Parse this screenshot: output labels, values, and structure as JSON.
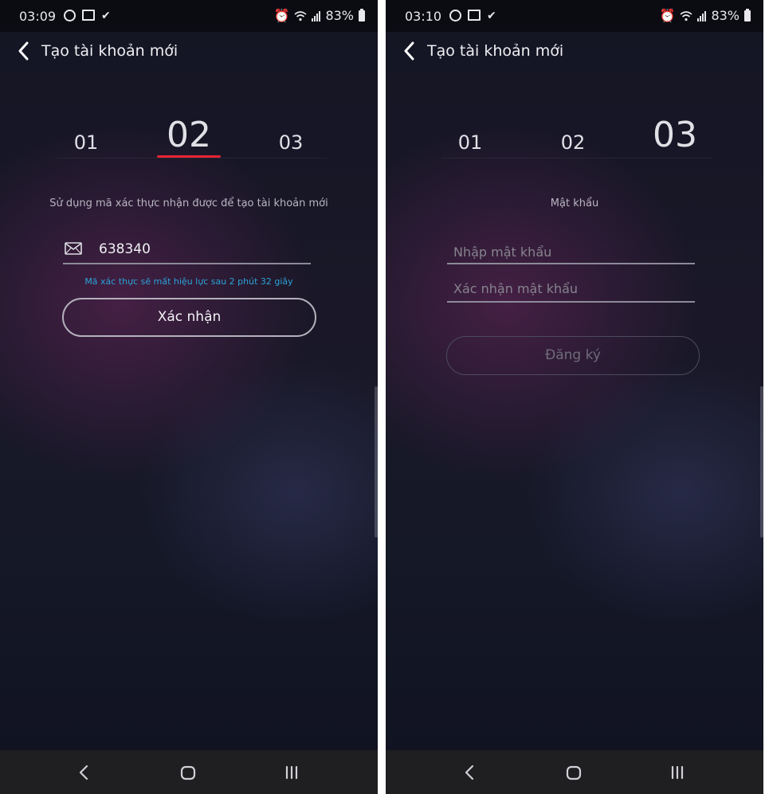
{
  "left": {
    "status": {
      "time": "03:09",
      "battery": "83%"
    },
    "header": {
      "title": "Tạo tài khoản mới"
    },
    "steps": [
      "01",
      "02",
      "03"
    ],
    "instruction": "Sử dụng mã xác thực nhận được để tạo tài khoản mới",
    "code_field": {
      "value": "638340"
    },
    "hint": "Mã xác thực sẽ mất hiệu lực sau 2 phút 32 giây",
    "confirm_button": "Xác nhận"
  },
  "right": {
    "status": {
      "time": "03:10",
      "battery": "83%"
    },
    "header": {
      "title": "Tạo tài khoản mới"
    },
    "steps": [
      "01",
      "02",
      "03"
    ],
    "section_label": "Mật khẩu",
    "password_field": {
      "placeholder": "Nhập mật khẩu"
    },
    "confirm_password_field": {
      "placeholder": "Xác nhận mật khẩu"
    },
    "register_button": "Đăng ký"
  },
  "colors": {
    "accent": "#e52535",
    "hint": "#2aa3d8",
    "background": "#161726"
  },
  "icons": [
    "back-chevron-icon",
    "mail-icon",
    "alarm-icon",
    "wifi-icon",
    "signal-icon",
    "battery-icon",
    "nav-back-icon",
    "nav-home-icon",
    "nav-recents-icon"
  ]
}
